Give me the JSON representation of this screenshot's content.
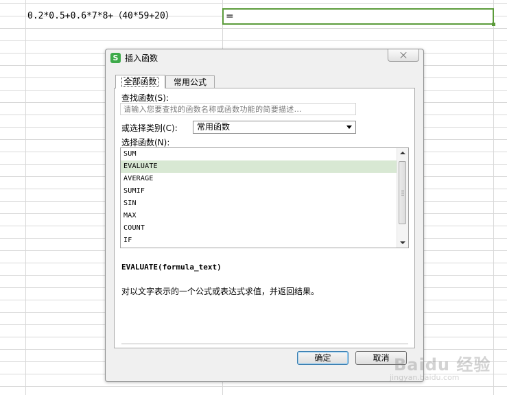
{
  "sheet": {
    "cell_a1": "0.2*0.5+0.6*7*8+（40*59+20）",
    "cell_b1": "="
  },
  "dialog": {
    "title": "插入函数",
    "app_icon": "S",
    "tabs": [
      {
        "label": "全部函数",
        "selected": true
      },
      {
        "label": "常用公式",
        "selected": false
      }
    ],
    "search": {
      "label": "查找函数(S):",
      "placeholder": "请输入您要查找的函数名称或函数功能的简要描述..."
    },
    "category": {
      "label": "或选择类别(C):",
      "value": "常用函数"
    },
    "function_list": {
      "label": "选择函数(N):",
      "items": [
        "SUM",
        "EVALUATE",
        "AVERAGE",
        "SUMIF",
        "SIN",
        "MAX",
        "COUNT",
        "IF"
      ],
      "selected": "EVALUATE"
    },
    "signature": "EVALUATE(formula_text)",
    "description": "对以文字表示的一个公式或表达式求值，并返回结果。",
    "buttons": {
      "ok": "确定",
      "cancel": "取消"
    }
  },
  "watermark": {
    "text": "Baidu 经验",
    "sub": "jingyan.baidu.com"
  },
  "colors": {
    "active_cell_border": "#5b9b3a",
    "selected_row": "#d8e8d3",
    "app_icon": "#3daa4a"
  }
}
